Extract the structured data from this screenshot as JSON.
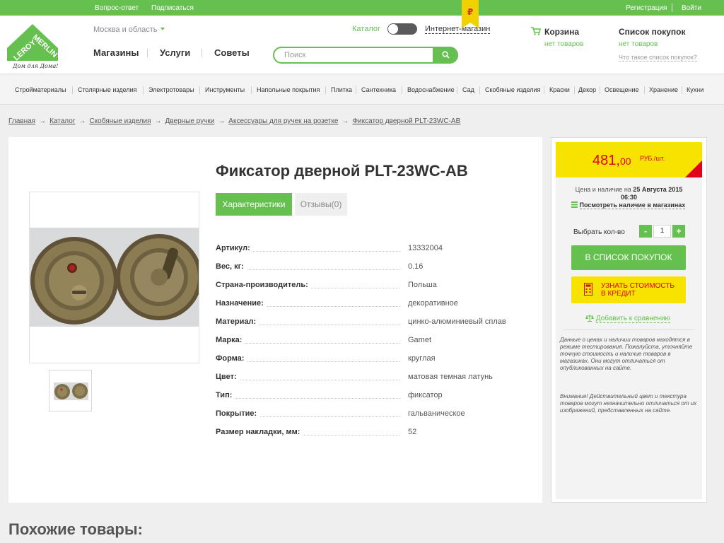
{
  "topbar": {
    "faq": "Вопрос-ответ",
    "subscribe": "Подписаться",
    "register": "Регистрация",
    "login": "Войти"
  },
  "header": {
    "region": "Москва и область",
    "nav": [
      "Магазины",
      "Услуги",
      "Советы"
    ],
    "catalog_label": "Каталог",
    "online_label": "Интернет-магазин",
    "ribbon_symbol": "₽",
    "search_placeholder": "Поиск",
    "cart_title": "Корзина",
    "cart_status": "нет товаров",
    "list_title": "Список покупок",
    "list_status": "нет товаров",
    "list_question": "Что такое список покупок?"
  },
  "categories": [
    "Стройматериалы",
    "Столярные изделия",
    "Электротовары",
    "Инструменты",
    "Напольные покрытия",
    "Плитка",
    "Сантехника",
    "Водоснабжение",
    "Сад",
    "Скобяные изделия",
    "Краски",
    "Декор",
    "Освещение",
    "Хранение",
    "Кухни"
  ],
  "breadcrumbs": [
    "Главная",
    "Каталог",
    "Скобяные изделия",
    "Дверные ручки",
    "Аксессуары для ручек на розетке",
    "Фиксатор дверной PLT-23WC-AB"
  ],
  "product": {
    "title": "Фиксатор дверной PLT-23WC-AB",
    "tab_specs": "Характеристики",
    "tab_reviews": "Отзывы(0)",
    "specs": [
      {
        "k": "Артикул:",
        "v": "13332004"
      },
      {
        "k": "Вес, кг:",
        "v": "0.16"
      },
      {
        "k": "Страна-производитель:",
        "v": "Польша"
      },
      {
        "k": "Назначение:",
        "v": "декоративное"
      },
      {
        "k": "Материал:",
        "v": "цинко-алюминиевый сплав"
      },
      {
        "k": "Марка:",
        "v": "Gamet"
      },
      {
        "k": "Форма:",
        "v": "круглая"
      },
      {
        "k": "Цвет:",
        "v": "матовая темная латунь"
      },
      {
        "k": "Тип:",
        "v": "фиксатор"
      },
      {
        "k": "Покрытие:",
        "v": "гальваническое"
      },
      {
        "k": "Размер накладки, мм:",
        "v": "52"
      }
    ]
  },
  "sidebar": {
    "price_main": "481,",
    "price_cents": "00",
    "price_unit": "РУБ./шт.",
    "avail_text": "Цена и наличие на",
    "avail_date": "25 Августа 2015",
    "avail_time": "06:30",
    "avail_link": "Посмотреть наличие в магазинах",
    "qty_label": "Выбрать кол-во",
    "qty_minus": "-",
    "qty_value": "1",
    "qty_plus": "+",
    "btn_list": "В СПИСОК ПОКУПОК",
    "btn_credit_line1": "УЗНАТЬ СТОИМОСТЬ",
    "btn_credit_line2": "В КРЕДИТ",
    "compare": "Добавить к сравнению",
    "note1": "Данные о ценах и наличии товаров находятся в режиме тестирования. Пожалуйста, уточняйте точную стоимость и наличие товаров в магазинах. Они могут отличаться от опубликованных на сайте.",
    "note2": "Внимание! Действительный цвет и текстура товаров могут незначительно отличаться от их изображений, представленных на сайте."
  },
  "similar_title": "Похожие товары:",
  "colors": {
    "brand_green": "#66c050",
    "price_yellow": "#f7e200",
    "price_red": "#e3001b"
  }
}
